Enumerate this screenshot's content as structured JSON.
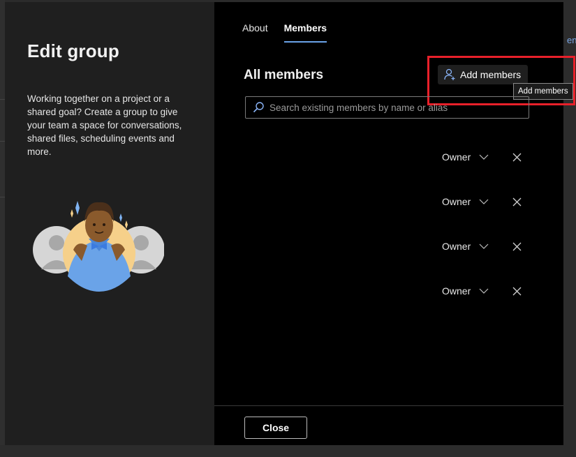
{
  "background": {
    "right_edge_text": "end"
  },
  "dialog": {
    "left_panel": {
      "title": "Edit group",
      "description": "Working together on a project or a shared goal? Create a group to give your team a space for conversations, shared files, scheduling events and more.",
      "illustration_icon": "group-people-illustration"
    },
    "tabs": [
      {
        "label": "About",
        "active": false
      },
      {
        "label": "Members",
        "active": true
      }
    ],
    "section_title": "All members",
    "add_members": {
      "label": "Add members",
      "icon": "add-person-icon",
      "tooltip": "Add members"
    },
    "search": {
      "placeholder": "Search existing members by name or alias",
      "value": ""
    },
    "members": [
      {
        "role": "Owner"
      },
      {
        "role": "Owner"
      },
      {
        "role": "Owner"
      },
      {
        "role": "Owner"
      }
    ],
    "close_label": "Close"
  },
  "colors": {
    "accent": "#6aa3e8",
    "highlight": "#e8202a",
    "dialog_bg": "#000000",
    "left_panel_bg": "#1f1f1f"
  }
}
